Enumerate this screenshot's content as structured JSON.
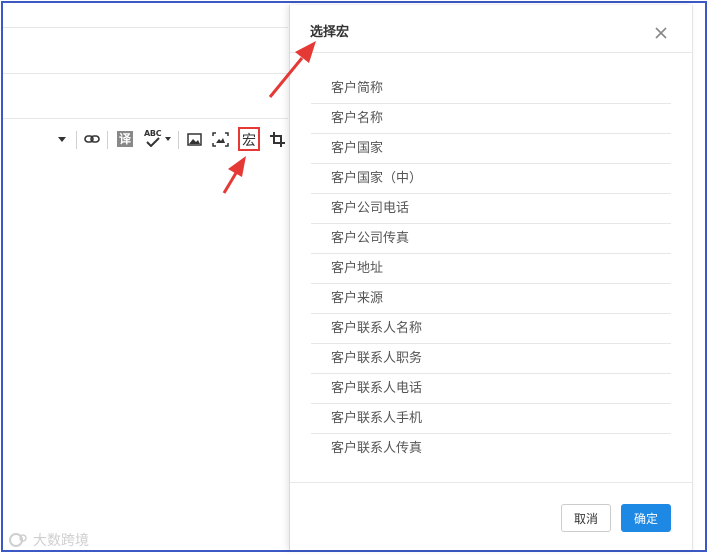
{
  "toolbar": {
    "translate_label": "译",
    "spellcheck_label": "ABC",
    "macro_label": "宏"
  },
  "modal": {
    "title": "选择宏",
    "items": [
      "客户简称",
      "客户名称",
      "客户国家",
      "客户国家（中）",
      "客户公司电话",
      "客户公司传真",
      "客户地址",
      "客户来源",
      "客户联系人名称",
      "客户联系人职务",
      "客户联系人电话",
      "客户联系人手机",
      "客户联系人传真"
    ],
    "cancel_label": "取消",
    "ok_label": "确定"
  },
  "watermark": {
    "text": "大数跨境"
  },
  "colors": {
    "frame_border": "#3b58c4",
    "primary_button": "#1e88e5",
    "annotation_red": "#e53935"
  }
}
